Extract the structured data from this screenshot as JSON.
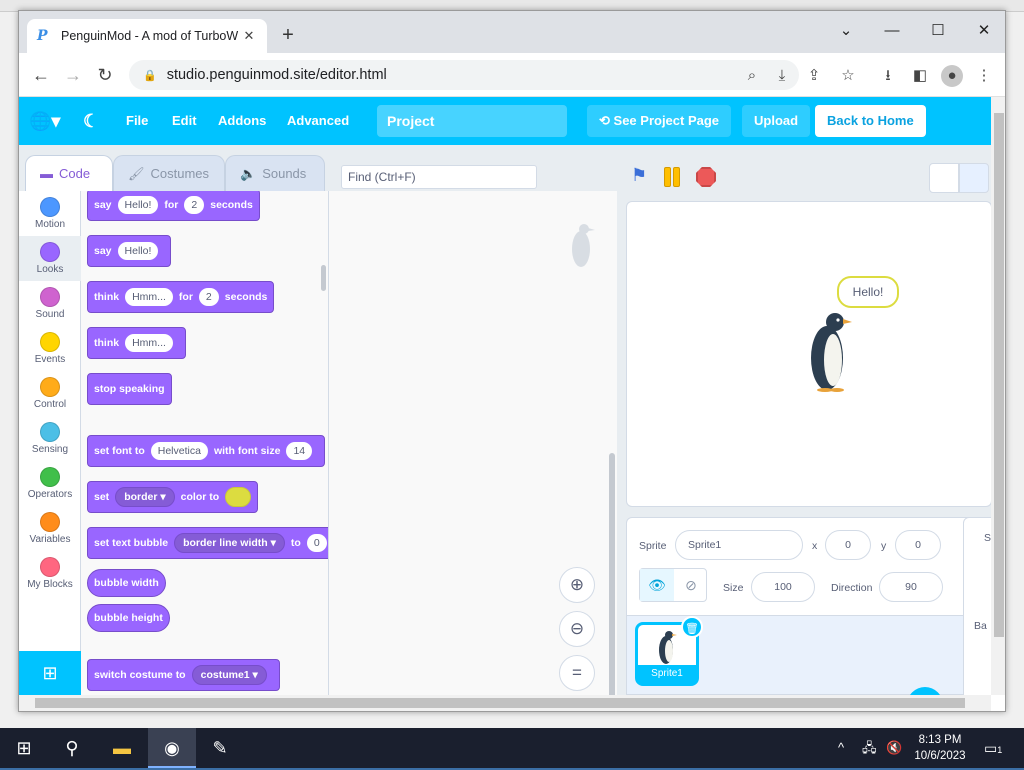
{
  "browser": {
    "tab_title": "PenguinMod - A mod of TurboW",
    "url": "studio.penguinmod.site/editor.html"
  },
  "menubar": {
    "file": "File",
    "addons": "Addons",
    "edit": "Edit",
    "advanced": "Advanced",
    "project_name": "Project",
    "see_project": "See Project Page",
    "upload": "Upload",
    "back_home": "Back to Home"
  },
  "editor_tabs": {
    "code": "Code",
    "costumes": "Costumes",
    "sounds": "Sounds"
  },
  "find_placeholder": "Find (Ctrl+F)",
  "categories": [
    {
      "label": "Motion",
      "color": "#4c97ff"
    },
    {
      "label": "Looks",
      "color": "#9966ff"
    },
    {
      "label": "Sound",
      "color": "#cf63cf"
    },
    {
      "label": "Events",
      "color": "#ffd500"
    },
    {
      "label": "Control",
      "color": "#ffab19"
    },
    {
      "label": "Sensing",
      "color": "#4cbfe6"
    },
    {
      "label": "Operators",
      "color": "#40bf4a"
    },
    {
      "label": "Variables",
      "color": "#ff8c1a"
    },
    {
      "label": "My Blocks",
      "color": "#ff6680"
    }
  ],
  "blocks": {
    "b1": {
      "say": "say",
      "msg": "Hello!",
      "for": "for",
      "secs": "2",
      "unit": "seconds"
    },
    "b2": {
      "say": "say",
      "msg": "Hello!"
    },
    "b3": {
      "think": "think",
      "msg": "Hmm...",
      "for": "for",
      "secs": "2",
      "unit": "seconds"
    },
    "b4": {
      "think": "think",
      "msg": "Hmm..."
    },
    "b5": {
      "text": "stop speaking"
    },
    "b6": {
      "pre": "set font to",
      "font": "Helvetica",
      "mid": "with font size",
      "size": "14"
    },
    "b7": {
      "pre": "set",
      "opt": "border",
      "mid": "color to"
    },
    "b8": {
      "pre": "set text bubble",
      "opt": "border line width",
      "mid": "to",
      "val": "0"
    },
    "b9": {
      "text": "bubble width"
    },
    "b10": {
      "text": "bubble height"
    },
    "b11": {
      "pre": "switch costume to",
      "opt": "costume1"
    }
  },
  "stage": {
    "bubble_text": "Hello!"
  },
  "sprite_info": {
    "sprite_label": "Sprite",
    "sprite_name": "Sprite1",
    "x_label": "x",
    "x": "0",
    "y_label": "y",
    "y": "0",
    "show_label": "Show",
    "size_label": "Size",
    "size": "100",
    "direction_label": "Direction",
    "direction": "90"
  },
  "sprite_list": {
    "thumb_name": "Sprite1"
  },
  "stage_pane": {
    "tab_short": "S",
    "backdrops_short": "Ba"
  },
  "taskbar": {
    "time": "8:13 PM",
    "date": "10/6/2023",
    "notif_count": "1"
  },
  "colors": {
    "menubar": "#00c3ff",
    "looks": "#9966ff",
    "accent": "#855cd6"
  }
}
